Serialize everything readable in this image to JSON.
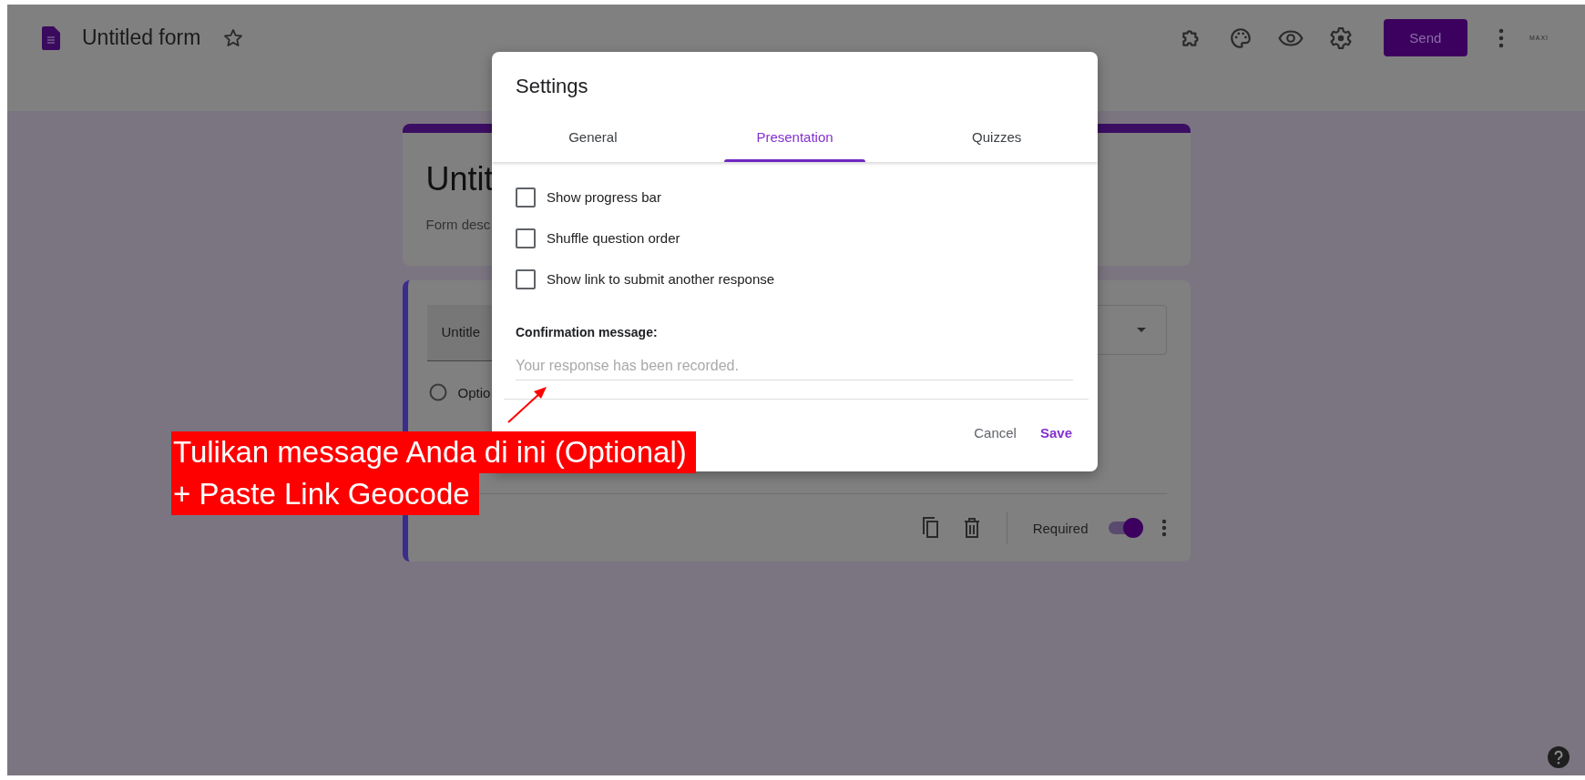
{
  "header": {
    "title": "Untitled form",
    "send_button": "Send",
    "logo_text": "MAXI"
  },
  "form": {
    "title": "Untit",
    "description": "Form desc",
    "question": {
      "title": "Untitle",
      "option": "Optio",
      "required_label": "Required",
      "required": true
    }
  },
  "dialog": {
    "title": "Settings",
    "tabs": [
      {
        "label": "General",
        "selected": false
      },
      {
        "label": "Presentation",
        "selected": true
      },
      {
        "label": "Quizzes",
        "selected": false
      }
    ],
    "options": [
      {
        "label": "Show progress bar",
        "checked": false
      },
      {
        "label": "Shuffle question order",
        "checked": false
      },
      {
        "label": "Show link to submit another response",
        "checked": false
      }
    ],
    "confirmation": {
      "label": "Confirmation message:",
      "placeholder": "Your response has been recorded."
    },
    "buttons": [
      {
        "label": "Cancel",
        "kind": "text"
      },
      {
        "label": "Save",
        "kind": "primary"
      }
    ]
  },
  "annotation": {
    "lines": [
      "Tulikan message Anda di ini (Optional)",
      "+ Paste Link Geocode"
    ]
  }
}
